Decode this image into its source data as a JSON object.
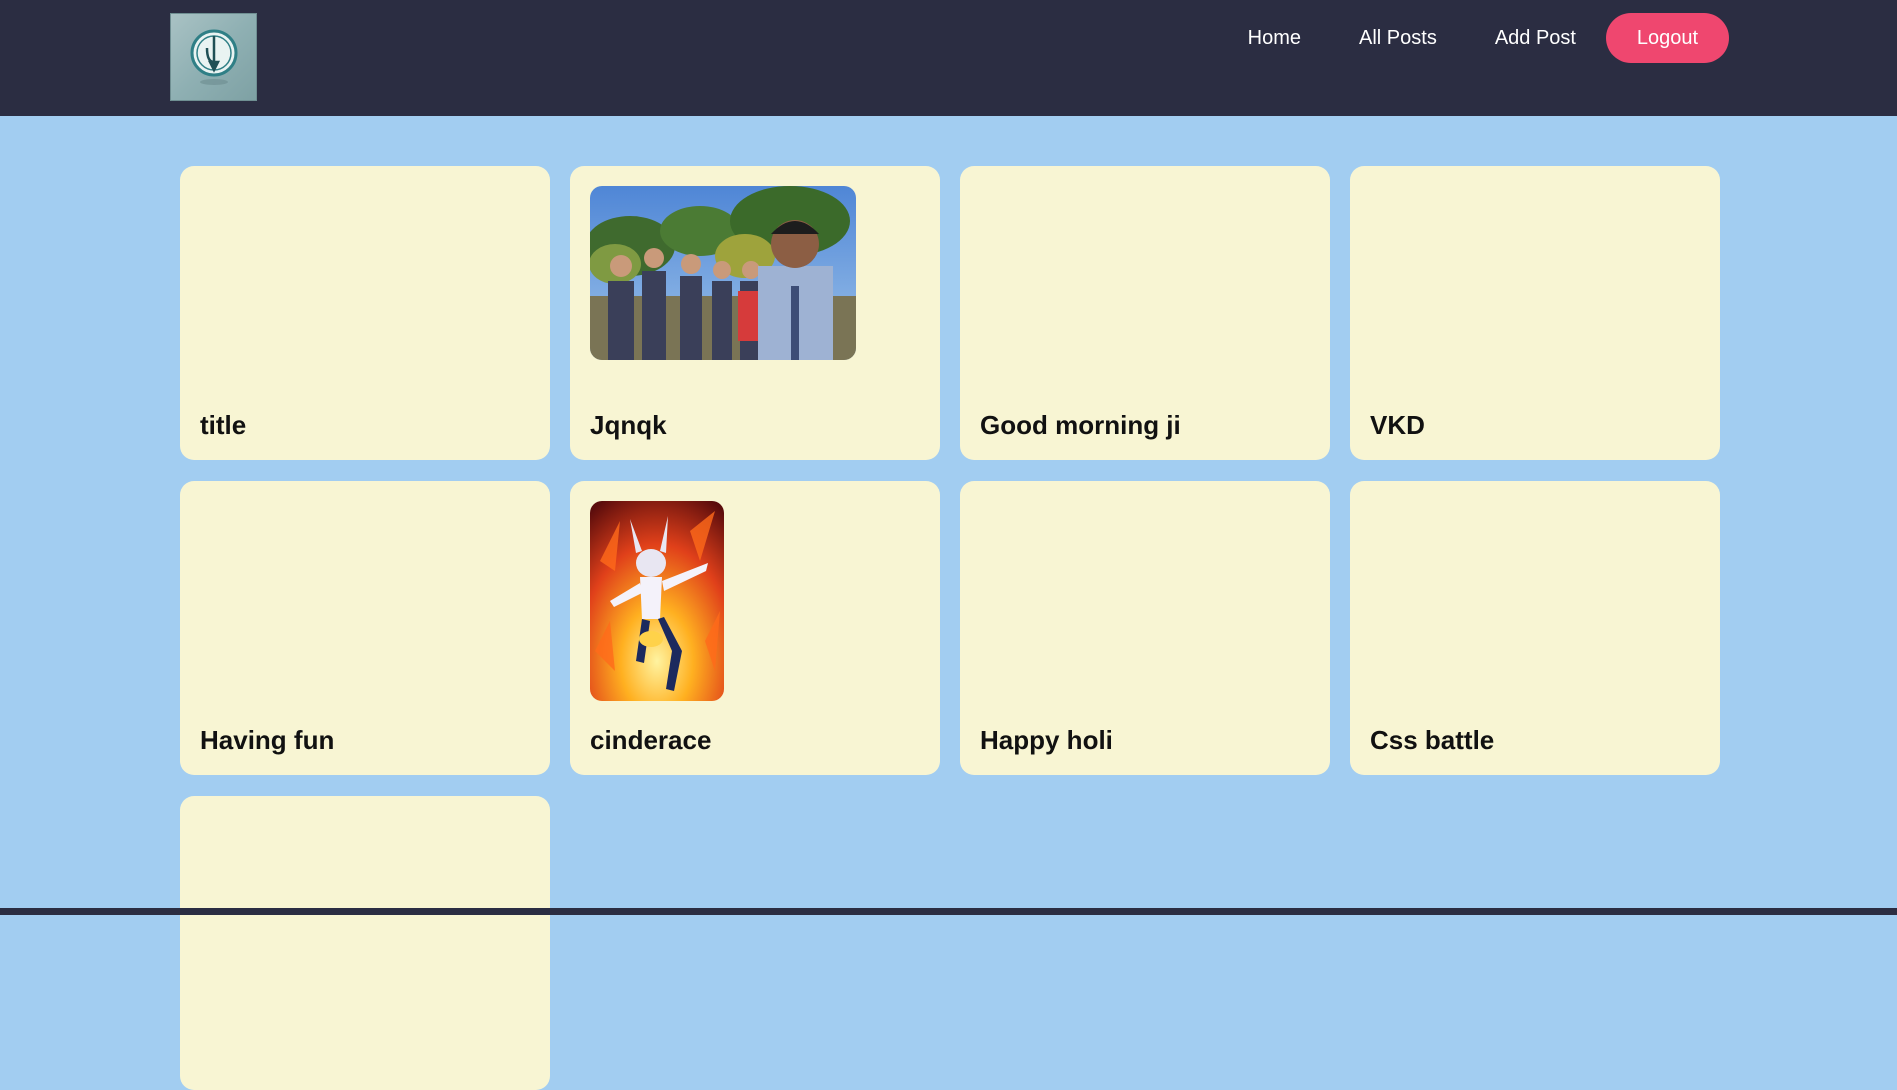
{
  "nav": {
    "logo_icon": "pen-logo-icon",
    "links": [
      "Home",
      "All Posts",
      "Add Post"
    ],
    "logout_label": "Logout"
  },
  "posts": [
    {
      "title": "title",
      "image": null
    },
    {
      "title": "Jqnqk",
      "image": "group-selfie-photo"
    },
    {
      "title": "Good morning ji",
      "image": null
    },
    {
      "title": "VKD",
      "image": null
    },
    {
      "title": "Having fun",
      "image": null
    },
    {
      "title": "cinderace",
      "image": "cinderace-artwork"
    },
    {
      "title": "Happy holi",
      "image": null
    },
    {
      "title": "Css battle",
      "image": null
    },
    {
      "title": "",
      "image": null
    }
  ],
  "colors": {
    "nav_bg": "#2b2d42",
    "page_bg": "#a2cdf1",
    "card_bg": "#f8f5d3",
    "logout_bg": "#ef476f"
  }
}
